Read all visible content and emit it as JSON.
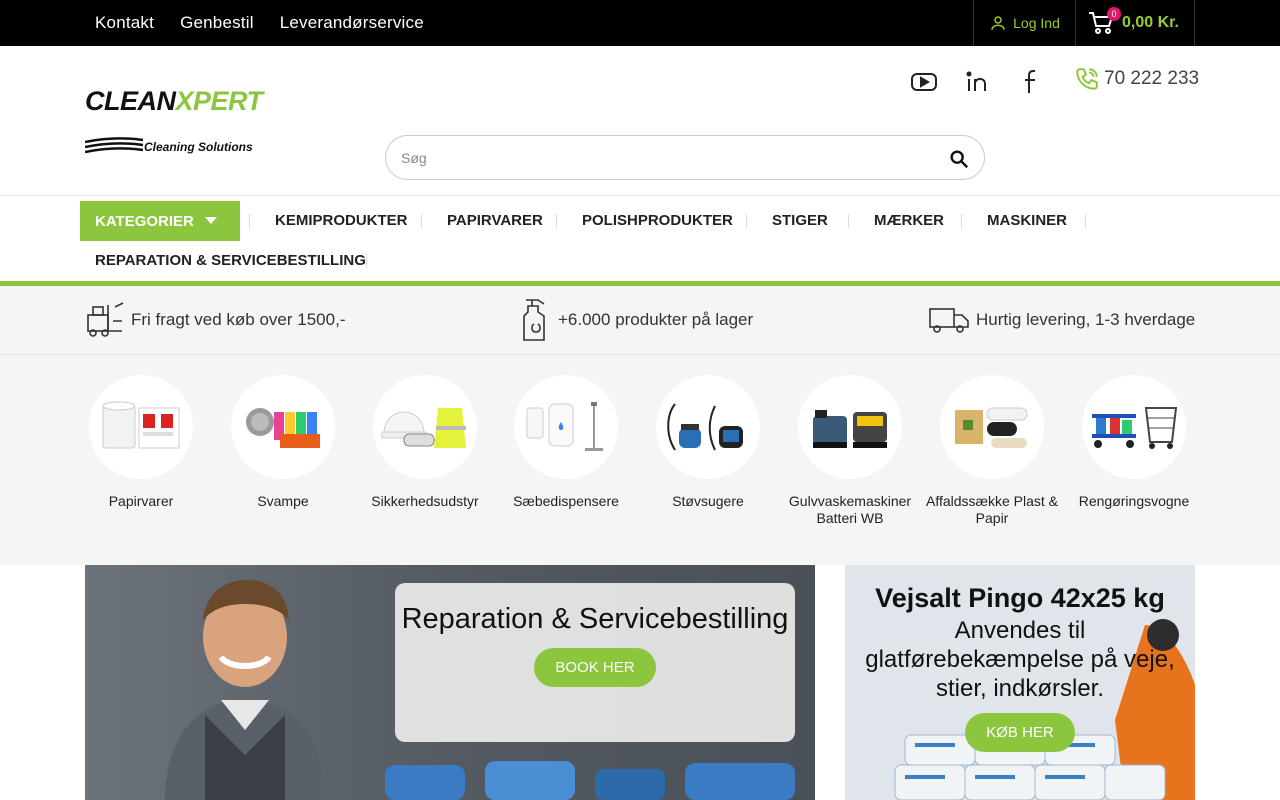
{
  "topbar": {
    "links": [
      "Kontakt",
      "Genbestil",
      "Leverandørservice"
    ],
    "login_label": "Log Ind",
    "cart_count": "0",
    "cart_total": "0,00 Kr."
  },
  "header": {
    "logo_brand_a": "CLEAN",
    "logo_brand_x": "X",
    "logo_brand_b": "PERT",
    "logo_tagline": "Cleaning Solutions",
    "phone": "70 222 233",
    "search_placeholder": "Søg"
  },
  "nav": {
    "categories_label": "KATEGORIER",
    "items": [
      "KEMIPRODUKTER",
      "PAPIRVARER",
      "POLISHPRODUKTER",
      "STIGER",
      "MÆRKER",
      "MASKINER",
      "REPARATION & SERVICEBESTILLING"
    ]
  },
  "usp": [
    "Fri fragt ved køb over 1500,-",
    "+6.000 produkter på lager",
    "Hurtig levering, 1-3 hverdage"
  ],
  "categories": [
    {
      "label": "Papirvarer"
    },
    {
      "label": "Svampe"
    },
    {
      "label": "Sikkerhedsudstyr"
    },
    {
      "label": "Sæbedispensere"
    },
    {
      "label": "Støvsugere"
    },
    {
      "label": "Gulvvaskemaskiner Batteri WB"
    },
    {
      "label": "Affaldssække Plast & Papir"
    },
    {
      "label": "Rengøringsvogne"
    }
  ],
  "banner_service": {
    "title": "Reparation & Servicebestilling",
    "button": "BOOK HER"
  },
  "banner_salt": {
    "title": "Vejsalt Pingo 42x25 kg",
    "text": "Anvendes til glatførebekæmpelse på veje, stier, indkørsler.",
    "button": "KØB HER"
  },
  "colors": {
    "accent": "#8cc63f",
    "topbar": "#000000",
    "badge": "#e0156b"
  }
}
